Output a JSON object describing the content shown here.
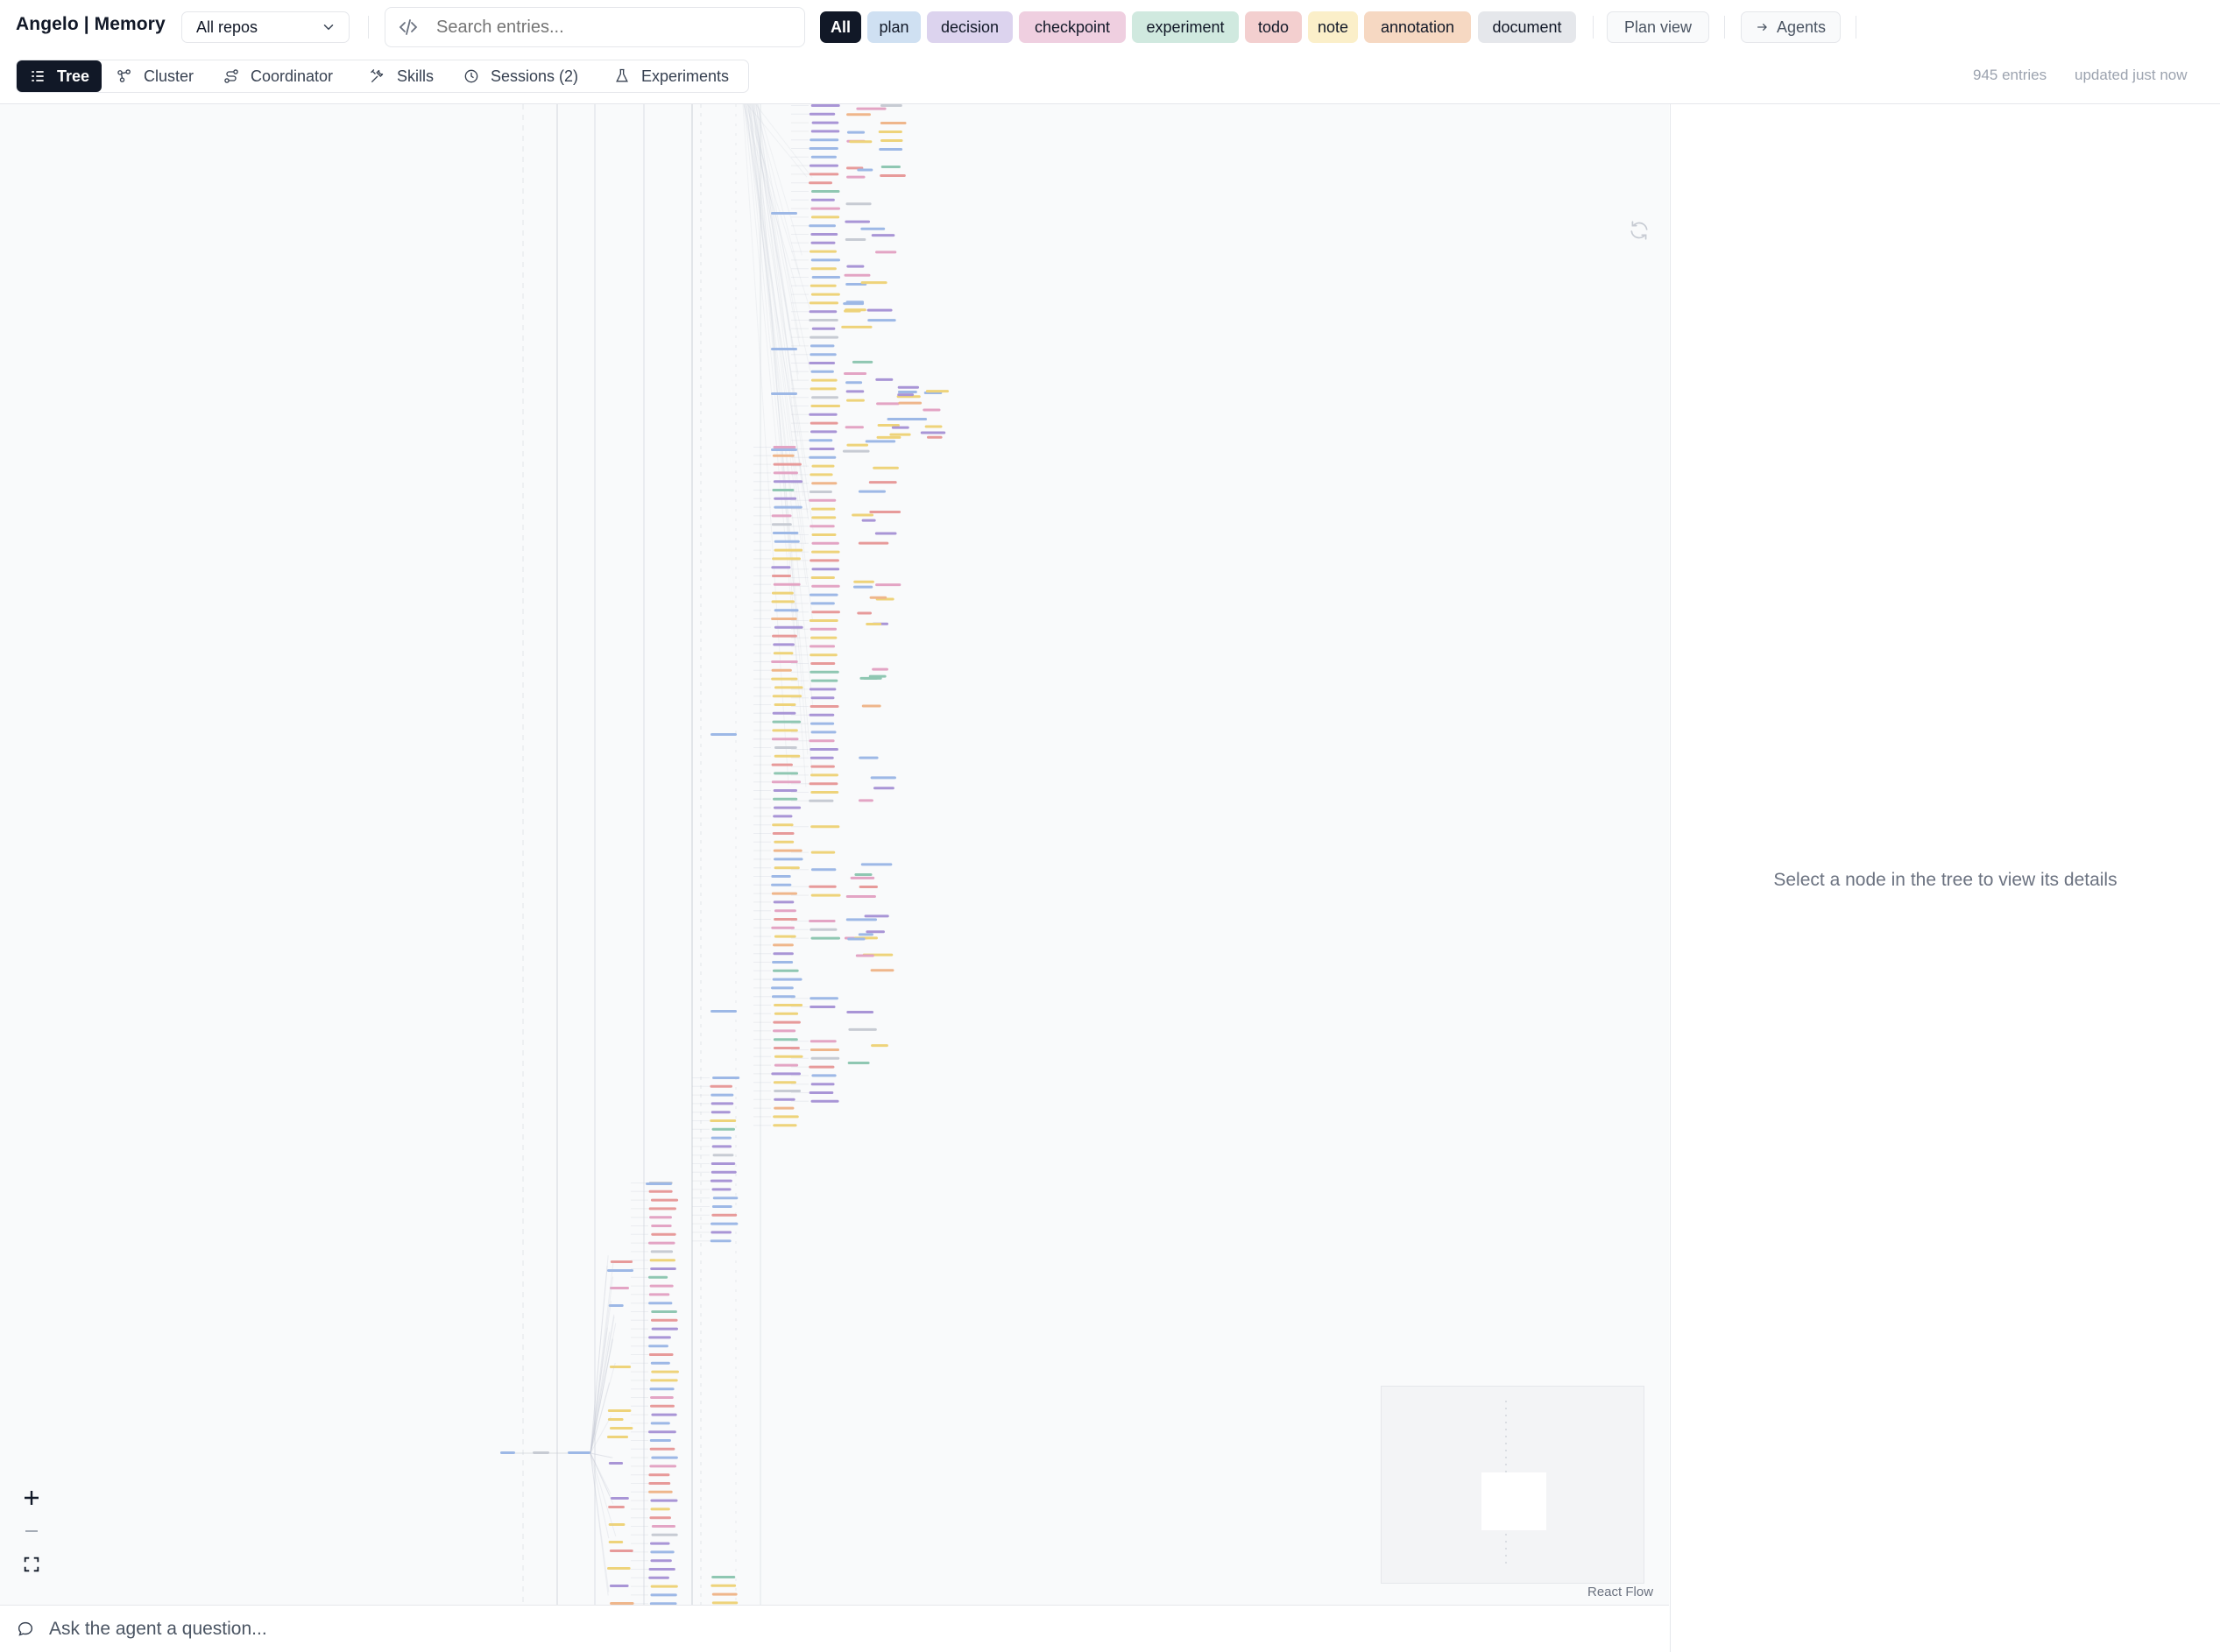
{
  "header": {
    "brand": "Angelo | Memory",
    "repo_select": "All repos",
    "search": {
      "placeholder": "Search entries..."
    },
    "filters": [
      {
        "label": "All",
        "bg": "#111827",
        "fg": "#ffffff"
      },
      {
        "label": "plan",
        "bg": "#cfe0f2",
        "fg": "#111827"
      },
      {
        "label": "decision",
        "bg": "#dcd3ee",
        "fg": "#111827"
      },
      {
        "label": "checkpoint",
        "bg": "#efcfe0",
        "fg": "#111827"
      },
      {
        "label": "experiment",
        "bg": "#d0e9df",
        "fg": "#111827"
      },
      {
        "label": "todo",
        "bg": "#f3cfcf",
        "fg": "#111827"
      },
      {
        "label": "note",
        "bg": "#fbefc9",
        "fg": "#111827"
      },
      {
        "label": "annotation",
        "bg": "#f6d8c2",
        "fg": "#111827"
      },
      {
        "label": "document",
        "bg": "#e5e7eb",
        "fg": "#111827"
      }
    ],
    "plan_view": "Plan view",
    "agents": "Agents"
  },
  "tabs": [
    {
      "label": "Tree",
      "icon": "list-tree-icon",
      "active": true
    },
    {
      "label": "Cluster",
      "icon": "cluster-icon"
    },
    {
      "label": "Coordinator",
      "icon": "route-icon"
    },
    {
      "label": "Skills",
      "icon": "wrench-icon"
    },
    {
      "label": "Sessions  (2)",
      "icon": "clock-icon"
    },
    {
      "label": "Experiments",
      "icon": "flask-icon"
    }
  ],
  "meta": {
    "entries": "945 entries",
    "updated": "updated just now"
  },
  "detail": {
    "empty": "Select a node in the tree to view its details"
  },
  "canvas": {
    "attribution": "React Flow",
    "zoom_in": "+",
    "zoom_out": "—"
  },
  "ask": {
    "placeholder": "Ask the agent a question..."
  },
  "colors": {
    "plan": "#9db8e6",
    "decision": "#a995d6",
    "checkpoint": "#e3a4c4",
    "experiment": "#8fc7b2",
    "todo": "#e79a9a",
    "note": "#eed37a",
    "annotation": "#efb68b",
    "document": "#c7cbd3",
    "edge": "#c4c9d2"
  }
}
